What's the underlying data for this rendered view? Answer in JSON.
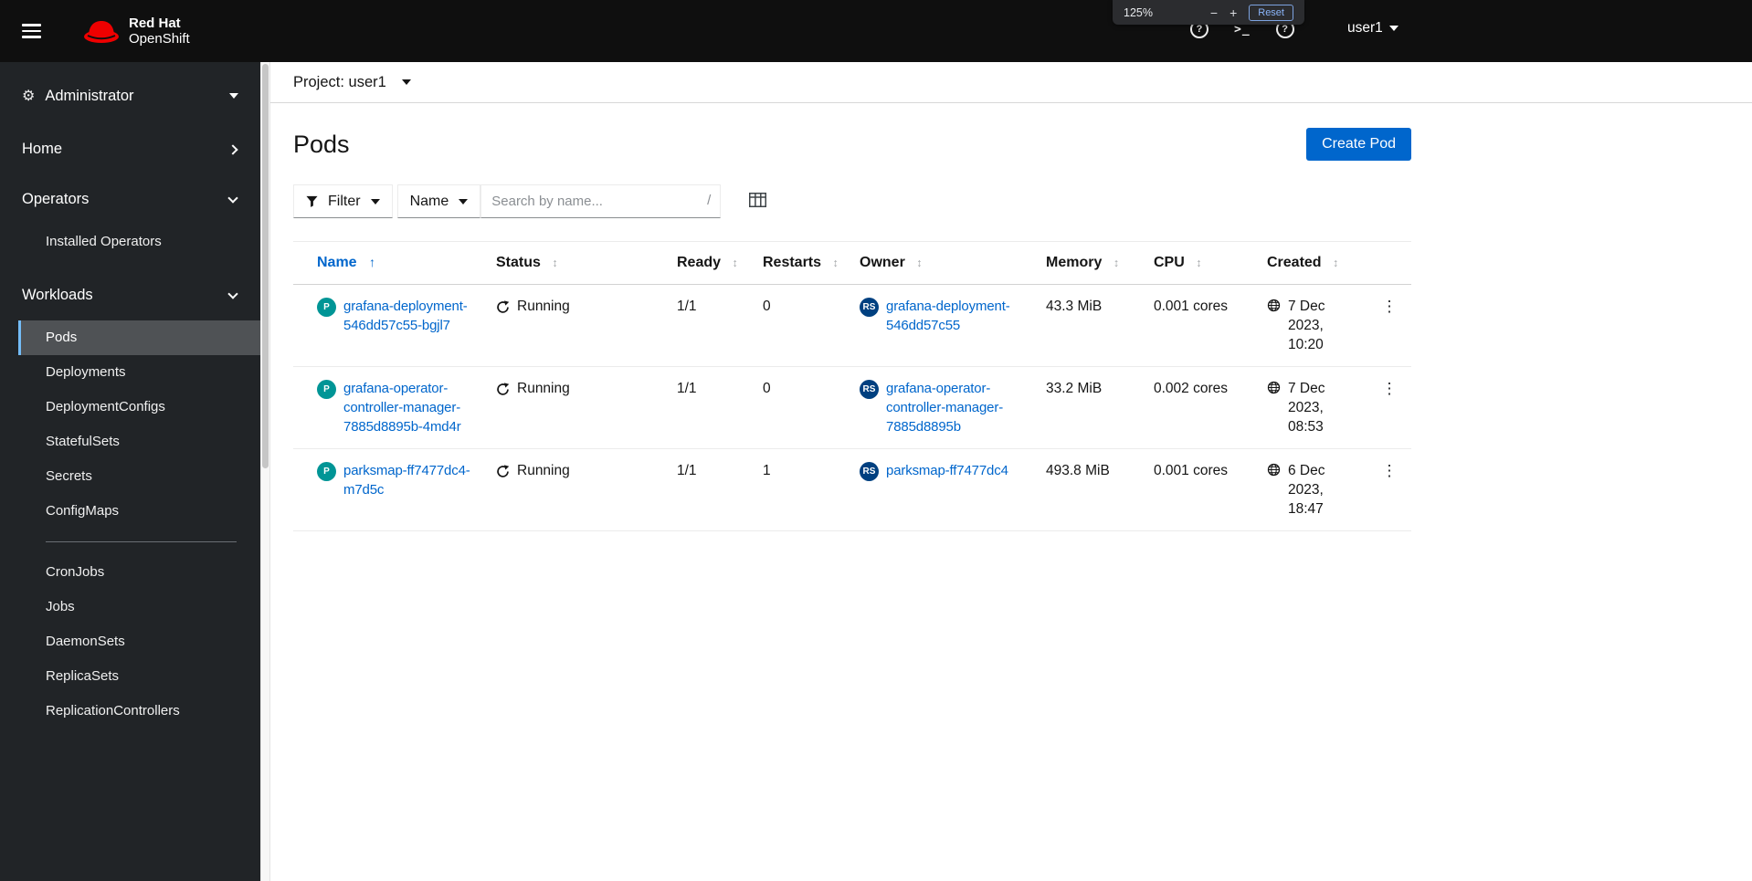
{
  "colors": {
    "brand_red": "#ee0000",
    "masthead_bg": "#0f0f0f",
    "sidebar_bg": "#212427",
    "nav_selected_bg": "#4f5255",
    "nav_selected_border": "#73bcf7",
    "link_blue": "#0066cc",
    "create_button_blue": "#0066cc",
    "pod_badge": "#009596",
    "replicaset_badge": "#004080"
  },
  "icons": {
    "gear": "⚙",
    "help": "?",
    "terminal": ">_",
    "kebab": "⋮",
    "sort_active": "↑",
    "sort_inactive": "↕"
  },
  "masthead": {
    "brand_top": "Red Hat",
    "brand_bottom": "OpenShift",
    "user": "user1"
  },
  "zoom_popup": {
    "level": "125%",
    "minus": "−",
    "plus": "+",
    "reset": "Reset"
  },
  "sidebar": {
    "perspective": "Administrator",
    "items": [
      {
        "label": "Home",
        "state": "collapsed"
      },
      {
        "label": "Operators",
        "state": "expanded"
      },
      {
        "label": "Workloads",
        "state": "expanded"
      }
    ],
    "operators_children": [
      "Installed Operators"
    ],
    "workloads_children_group1": [
      "Pods",
      "Deployments",
      "DeploymentConfigs",
      "StatefulSets",
      "Secrets",
      "ConfigMaps"
    ],
    "workloads_children_group2": [
      "CronJobs",
      "Jobs",
      "DaemonSets",
      "ReplicaSets",
      "ReplicationControllers"
    ],
    "selected_item": "Pods"
  },
  "project_bar": {
    "label": "Project: user1"
  },
  "page": {
    "title": "Pods",
    "create_button": "Create Pod"
  },
  "toolbar": {
    "filter": "Filter",
    "filter_by": "Name",
    "search_placeholder": "Search by name...",
    "search_shortcut": "/"
  },
  "table": {
    "columns": {
      "name": "Name",
      "status": "Status",
      "ready": "Ready",
      "restarts": "Restarts",
      "owner": "Owner",
      "memory": "Memory",
      "cpu": "CPU",
      "created": "Created"
    },
    "sort": {
      "column": "Name",
      "direction": "ascending"
    },
    "rows": [
      {
        "badge": "P",
        "name": "grafana-deployment-546dd57c55-bgjl7",
        "status": "Running",
        "ready": "1/1",
        "restarts": "0",
        "owner_badge": "RS",
        "owner": "grafana-deployment-546dd57c55",
        "memory": "43.3 MiB",
        "cpu": "0.001 cores",
        "created": "7 Dec 2023, 10:20"
      },
      {
        "badge": "P",
        "name": "grafana-operator-controller-manager-7885d8895b-4md4r",
        "status": "Running",
        "ready": "1/1",
        "restarts": "0",
        "owner_badge": "RS",
        "owner": "grafana-operator-controller-manager-7885d8895b",
        "memory": "33.2 MiB",
        "cpu": "0.002 cores",
        "created": "7 Dec 2023, 08:53"
      },
      {
        "badge": "P",
        "name": "parksmap-ff7477dc4-m7d5c",
        "status": "Running",
        "ready": "1/1",
        "restarts": "1",
        "owner_badge": "RS",
        "owner": "parksmap-ff7477dc4",
        "memory": "493.8 MiB",
        "cpu": "0.001 cores",
        "created": "6 Dec 2023, 18:47"
      }
    ]
  }
}
